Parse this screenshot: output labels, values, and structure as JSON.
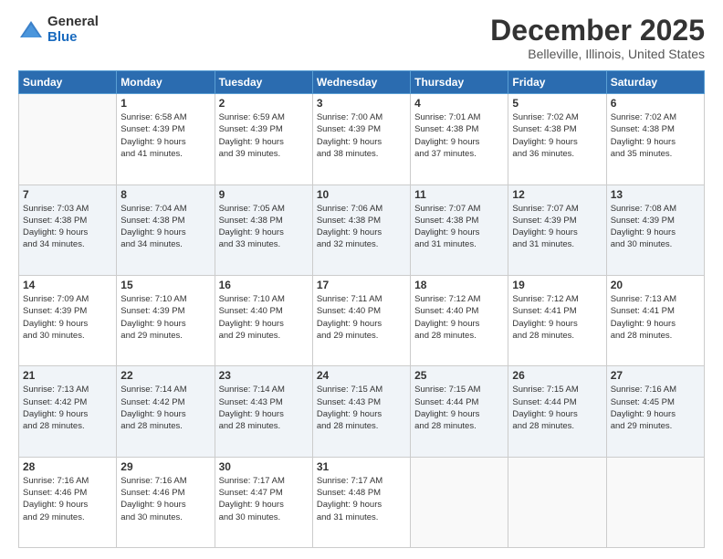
{
  "logo": {
    "general": "General",
    "blue": "Blue"
  },
  "header": {
    "title": "December 2025",
    "subtitle": "Belleville, Illinois, United States"
  },
  "weekdays": [
    "Sunday",
    "Monday",
    "Tuesday",
    "Wednesday",
    "Thursday",
    "Friday",
    "Saturday"
  ],
  "weeks": [
    [
      {
        "day": "",
        "info": ""
      },
      {
        "day": "1",
        "info": "Sunrise: 6:58 AM\nSunset: 4:39 PM\nDaylight: 9 hours\nand 41 minutes."
      },
      {
        "day": "2",
        "info": "Sunrise: 6:59 AM\nSunset: 4:39 PM\nDaylight: 9 hours\nand 39 minutes."
      },
      {
        "day": "3",
        "info": "Sunrise: 7:00 AM\nSunset: 4:39 PM\nDaylight: 9 hours\nand 38 minutes."
      },
      {
        "day": "4",
        "info": "Sunrise: 7:01 AM\nSunset: 4:38 PM\nDaylight: 9 hours\nand 37 minutes."
      },
      {
        "day": "5",
        "info": "Sunrise: 7:02 AM\nSunset: 4:38 PM\nDaylight: 9 hours\nand 36 minutes."
      },
      {
        "day": "6",
        "info": "Sunrise: 7:02 AM\nSunset: 4:38 PM\nDaylight: 9 hours\nand 35 minutes."
      }
    ],
    [
      {
        "day": "7",
        "info": "Sunrise: 7:03 AM\nSunset: 4:38 PM\nDaylight: 9 hours\nand 34 minutes."
      },
      {
        "day": "8",
        "info": "Sunrise: 7:04 AM\nSunset: 4:38 PM\nDaylight: 9 hours\nand 34 minutes."
      },
      {
        "day": "9",
        "info": "Sunrise: 7:05 AM\nSunset: 4:38 PM\nDaylight: 9 hours\nand 33 minutes."
      },
      {
        "day": "10",
        "info": "Sunrise: 7:06 AM\nSunset: 4:38 PM\nDaylight: 9 hours\nand 32 minutes."
      },
      {
        "day": "11",
        "info": "Sunrise: 7:07 AM\nSunset: 4:38 PM\nDaylight: 9 hours\nand 31 minutes."
      },
      {
        "day": "12",
        "info": "Sunrise: 7:07 AM\nSunset: 4:39 PM\nDaylight: 9 hours\nand 31 minutes."
      },
      {
        "day": "13",
        "info": "Sunrise: 7:08 AM\nSunset: 4:39 PM\nDaylight: 9 hours\nand 30 minutes."
      }
    ],
    [
      {
        "day": "14",
        "info": "Sunrise: 7:09 AM\nSunset: 4:39 PM\nDaylight: 9 hours\nand 30 minutes."
      },
      {
        "day": "15",
        "info": "Sunrise: 7:10 AM\nSunset: 4:39 PM\nDaylight: 9 hours\nand 29 minutes."
      },
      {
        "day": "16",
        "info": "Sunrise: 7:10 AM\nSunset: 4:40 PM\nDaylight: 9 hours\nand 29 minutes."
      },
      {
        "day": "17",
        "info": "Sunrise: 7:11 AM\nSunset: 4:40 PM\nDaylight: 9 hours\nand 29 minutes."
      },
      {
        "day": "18",
        "info": "Sunrise: 7:12 AM\nSunset: 4:40 PM\nDaylight: 9 hours\nand 28 minutes."
      },
      {
        "day": "19",
        "info": "Sunrise: 7:12 AM\nSunset: 4:41 PM\nDaylight: 9 hours\nand 28 minutes."
      },
      {
        "day": "20",
        "info": "Sunrise: 7:13 AM\nSunset: 4:41 PM\nDaylight: 9 hours\nand 28 minutes."
      }
    ],
    [
      {
        "day": "21",
        "info": "Sunrise: 7:13 AM\nSunset: 4:42 PM\nDaylight: 9 hours\nand 28 minutes."
      },
      {
        "day": "22",
        "info": "Sunrise: 7:14 AM\nSunset: 4:42 PM\nDaylight: 9 hours\nand 28 minutes."
      },
      {
        "day": "23",
        "info": "Sunrise: 7:14 AM\nSunset: 4:43 PM\nDaylight: 9 hours\nand 28 minutes."
      },
      {
        "day": "24",
        "info": "Sunrise: 7:15 AM\nSunset: 4:43 PM\nDaylight: 9 hours\nand 28 minutes."
      },
      {
        "day": "25",
        "info": "Sunrise: 7:15 AM\nSunset: 4:44 PM\nDaylight: 9 hours\nand 28 minutes."
      },
      {
        "day": "26",
        "info": "Sunrise: 7:15 AM\nSunset: 4:44 PM\nDaylight: 9 hours\nand 28 minutes."
      },
      {
        "day": "27",
        "info": "Sunrise: 7:16 AM\nSunset: 4:45 PM\nDaylight: 9 hours\nand 29 minutes."
      }
    ],
    [
      {
        "day": "28",
        "info": "Sunrise: 7:16 AM\nSunset: 4:46 PM\nDaylight: 9 hours\nand 29 minutes."
      },
      {
        "day": "29",
        "info": "Sunrise: 7:16 AM\nSunset: 4:46 PM\nDaylight: 9 hours\nand 30 minutes."
      },
      {
        "day": "30",
        "info": "Sunrise: 7:17 AM\nSunset: 4:47 PM\nDaylight: 9 hours\nand 30 minutes."
      },
      {
        "day": "31",
        "info": "Sunrise: 7:17 AM\nSunset: 4:48 PM\nDaylight: 9 hours\nand 31 minutes."
      },
      {
        "day": "",
        "info": ""
      },
      {
        "day": "",
        "info": ""
      },
      {
        "day": "",
        "info": ""
      }
    ]
  ]
}
